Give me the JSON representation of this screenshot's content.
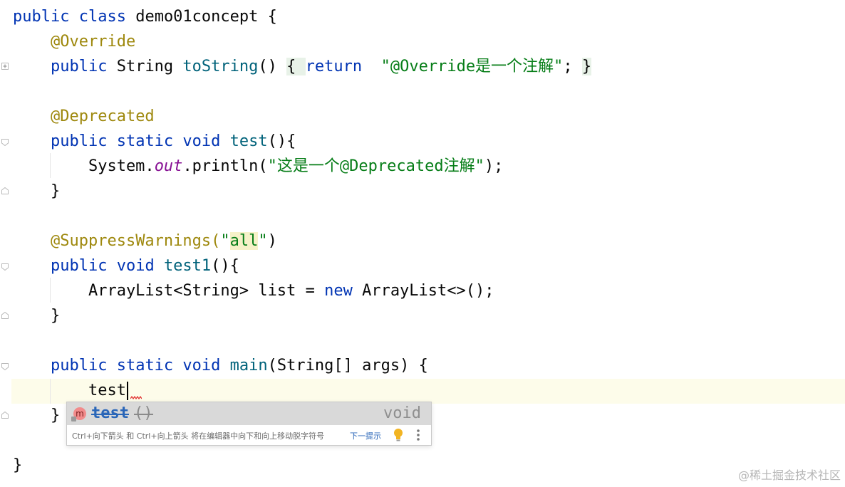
{
  "editor": {
    "lines": [
      {
        "id": "l1",
        "tokens": [
          {
            "t": "public ",
            "c": "kw"
          },
          {
            "t": "class ",
            "c": "kw"
          },
          {
            "t": "demo01concept {",
            "c": ""
          }
        ]
      },
      {
        "id": "l2",
        "tokens": [
          {
            "t": "    "
          },
          {
            "t": "@Override",
            "c": "ann"
          }
        ]
      },
      {
        "id": "l3",
        "tokens": [
          {
            "t": "    "
          },
          {
            "t": "public ",
            "c": "kw"
          },
          {
            "t": "String ",
            "c": ""
          },
          {
            "t": "toString",
            "c": "fn"
          },
          {
            "t": "() ",
            "c": ""
          },
          {
            "t": "{ ",
            "c": "fold-bg"
          },
          {
            "t": "return  ",
            "c": "kw"
          },
          {
            "t": "\"@Override是一个注解\"",
            "c": "str"
          },
          {
            "t": "; ",
            "c": ""
          },
          {
            "t": "}",
            "c": "fold-bg"
          }
        ]
      },
      {
        "id": "l4",
        "tokens": []
      },
      {
        "id": "l5",
        "tokens": [
          {
            "t": "    "
          },
          {
            "t": "@Deprecated",
            "c": "ann"
          }
        ]
      },
      {
        "id": "l6",
        "tokens": [
          {
            "t": "    "
          },
          {
            "t": "public ",
            "c": "kw"
          },
          {
            "t": "static ",
            "c": "kw"
          },
          {
            "t": "void ",
            "c": "kw"
          },
          {
            "t": "test",
            "c": "fn"
          },
          {
            "t": "(){",
            "c": ""
          }
        ]
      },
      {
        "id": "l7",
        "tokens": [
          {
            "t": "        System.",
            "c": ""
          },
          {
            "t": "out",
            "c": "stat"
          },
          {
            "t": ".println(",
            "c": ""
          },
          {
            "t": "\"这是一个@Deprecated注解\"",
            "c": "str"
          },
          {
            "t": ");",
            "c": ""
          }
        ]
      },
      {
        "id": "l8",
        "tokens": [
          {
            "t": "    }",
            "c": ""
          }
        ]
      },
      {
        "id": "l9",
        "tokens": []
      },
      {
        "id": "l10",
        "tokens": [
          {
            "t": "    "
          },
          {
            "t": "@SuppressWarnings(",
            "c": "ann"
          },
          {
            "t": "\"",
            "c": "str"
          },
          {
            "t": "all",
            "c": "str hl-all"
          },
          {
            "t": "\"",
            "c": "str"
          },
          {
            "t": ")",
            "c": ""
          }
        ]
      },
      {
        "id": "l11",
        "tokens": [
          {
            "t": "    "
          },
          {
            "t": "public ",
            "c": "kw"
          },
          {
            "t": "void ",
            "c": "kw"
          },
          {
            "t": "test1",
            "c": "fn"
          },
          {
            "t": "(){",
            "c": ""
          }
        ]
      },
      {
        "id": "l12",
        "tokens": [
          {
            "t": "        ArrayList<String> list = ",
            "c": ""
          },
          {
            "t": "new ",
            "c": "kw"
          },
          {
            "t": "ArrayList<>();",
            "c": ""
          }
        ]
      },
      {
        "id": "l13",
        "tokens": [
          {
            "t": "    }",
            "c": ""
          }
        ]
      },
      {
        "id": "l14",
        "tokens": []
      },
      {
        "id": "l15",
        "tokens": [
          {
            "t": "    "
          },
          {
            "t": "public ",
            "c": "kw"
          },
          {
            "t": "static ",
            "c": "kw"
          },
          {
            "t": "void ",
            "c": "kw"
          },
          {
            "t": "main",
            "c": "fn"
          },
          {
            "t": "(String[] args) {",
            "c": ""
          }
        ]
      },
      {
        "id": "l16",
        "tokens": [
          {
            "t": "        test",
            "c": ""
          }
        ]
      },
      {
        "id": "l17",
        "tokens": [
          {
            "t": "    }",
            "c": ""
          }
        ]
      },
      {
        "id": "l18",
        "tokens": []
      },
      {
        "id": "l19",
        "tokens": [
          {
            "t": "}",
            "c": ""
          }
        ]
      }
    ]
  },
  "completion": {
    "item": {
      "icon": "m",
      "name": "test",
      "params": "()",
      "type": "void"
    },
    "hint": "Ctrl+向下箭头 和 Ctrl+向上箭头 将在编辑器中向下和向上移动脱字符号",
    "hint_link": "下一提示"
  },
  "watermark": "@稀土掘金技术社区",
  "colors": {
    "keyword": "#0033b3",
    "annotation": "#9e880d",
    "method": "#00627a",
    "string": "#067d17",
    "static_field": "#871094"
  }
}
